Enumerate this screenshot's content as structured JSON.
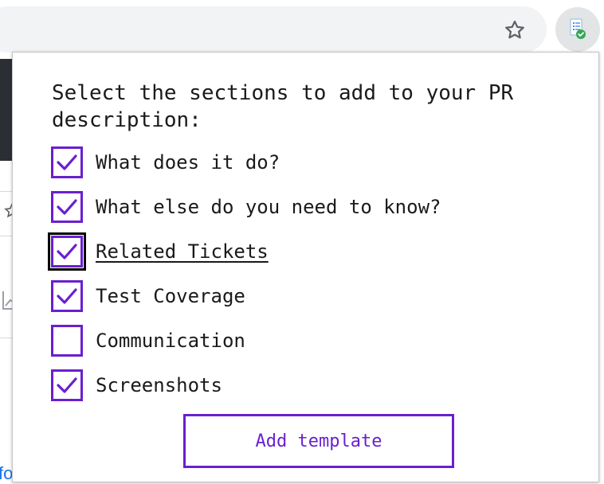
{
  "browser": {
    "bookmark_icon": "star-outline-icon",
    "extension_icon": "document-check-icon"
  },
  "popup": {
    "prompt": "Select the sections to add to your PR description:",
    "options": [
      {
        "label": "What does it do?",
        "checked": true
      },
      {
        "label": "What else do you need to know?",
        "checked": true
      },
      {
        "label": "Related Tickets",
        "checked": true,
        "focused": true
      },
      {
        "label": "Test Coverage",
        "checked": true
      },
      {
        "label": "Communication",
        "checked": false
      },
      {
        "label": "Screenshots",
        "checked": true
      }
    ],
    "add_button_label": "Add template"
  },
  "colors": {
    "accent": "#6a1fd0",
    "text": "#1a1a1a",
    "toolbar_bg": "#f1f3f4",
    "extension_check": "#34a853"
  }
}
